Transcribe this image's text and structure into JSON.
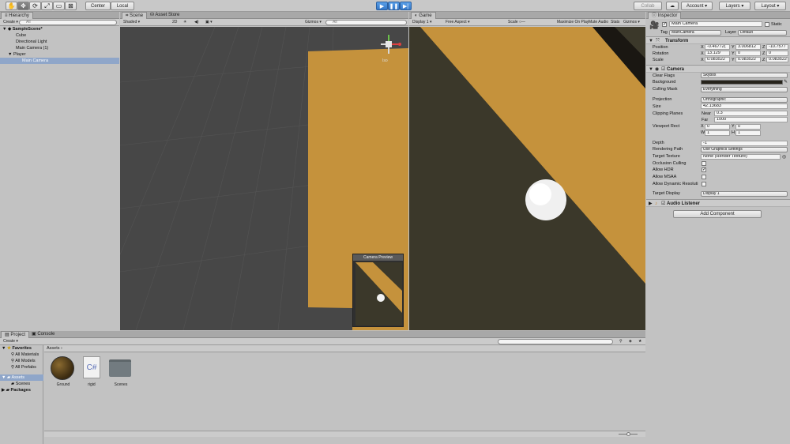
{
  "toolbar": {
    "center_label": "Center",
    "local_label": "Local",
    "collab_label": "Collab",
    "account_label": "Account",
    "layers_label": "Layers",
    "layout_label": "Layout"
  },
  "hierarchy": {
    "tab_label": "Hierarchy",
    "create_label": "Create",
    "search_placeholder": "All",
    "items": [
      {
        "label": "SampleScene*"
      },
      {
        "label": "Cube"
      },
      {
        "label": "Directional Light"
      },
      {
        "label": "Main Camera (1)"
      },
      {
        "label": "Player"
      },
      {
        "label": "Main Camera"
      }
    ]
  },
  "scene": {
    "tab_label": "Scene",
    "asset_store_label": "Asset Store",
    "shaded_label": "Shaded",
    "mode_2d_label": "2D",
    "gizmos_label": "Gizmos",
    "search_placeholder": "All",
    "iso_label": "Iso",
    "camera_preview_label": "Camera Preview"
  },
  "game": {
    "tab_label": "Game",
    "display_label": "Display 1",
    "aspect_label": "Free Aspect",
    "scale_label": "Scale",
    "maximize_label": "Maximize On Play",
    "mute_label": "Mute Audio",
    "stats_label": "Stats",
    "gizmos_label": "Gizmos"
  },
  "inspector": {
    "tab_label": "Inspector",
    "object_name": "Main Camera",
    "static_label": "Static",
    "tag_label": "Tag",
    "tag_value": "MainCamera",
    "layer_label": "Layer",
    "layer_value": "Default",
    "transform": {
      "title": "Transform",
      "position_label": "Position",
      "rotation_label": "Rotation",
      "scale_label": "Scale",
      "position": {
        "x": "-0.46772(",
        "y": "3.006812",
        "z": "-10.7577"
      },
      "rotation": {
        "x": "13.129",
        "y": "0",
        "z": "0"
      },
      "scale": {
        "x": "0.083522",
        "y": "0.083522",
        "z": "0.083522"
      }
    },
    "camera": {
      "title": "Camera",
      "clear_flags_label": "Clear Flags",
      "clear_flags_value": "Skybox",
      "background_label": "Background",
      "culling_mask_label": "Culling Mask",
      "culling_mask_value": "Everything",
      "projection_label": "Projection",
      "projection_value": "Orthographic",
      "size_label": "Size",
      "size_value": "42.13683",
      "clipping_label": "Clipping Planes",
      "near_label": "Near",
      "near_value": "0.3",
      "far_label": "Far",
      "far_value": "1000",
      "viewport_label": "Viewport Rect",
      "vp_x_label": "X",
      "vp_x": "0",
      "vp_y_label": "Y",
      "vp_y": "0",
      "vp_w_label": "W",
      "vp_w": "1",
      "vp_h_label": "H",
      "vp_h": "1",
      "depth_label": "Depth",
      "depth_value": "-1",
      "rendering_path_label": "Rendering Path",
      "rendering_path_value": "Use Graphics Settings",
      "target_texture_label": "Target Texture",
      "target_texture_value": "None (Render Texture)",
      "occlusion_label": "Occlusion Culling",
      "hdr_label": "Allow HDR",
      "msaa_label": "Allow MSAA",
      "dynamic_label": "Allow Dynamic Resoluti",
      "target_display_label": "Target Display",
      "target_display_value": "Display 1"
    },
    "audio_listener_title": "Audio Listener",
    "add_component_label": "Add Component"
  },
  "project": {
    "tab_label": "Project",
    "console_label": "Console",
    "create_label": "Create",
    "favorites_label": "Favorites",
    "favorites": [
      "All Materials",
      "All Models",
      "All Prefabs"
    ],
    "assets_label": "Assets",
    "scenes_label": "Scenes",
    "packages_label": "Packages",
    "breadcrumb": "Assets",
    "assets": [
      {
        "name": "Ground",
        "icon": "material-icon"
      },
      {
        "name": "rigid",
        "icon": "csharp-icon"
      },
      {
        "name": "Scenes",
        "icon": "folder-icon"
      }
    ]
  },
  "colors": {
    "panel_bg": "#c2c2c2",
    "scene_bg": "#474747",
    "game_bg": "#3b382a",
    "plane": "#c5923c",
    "selection": "#8fa6c9",
    "play_blue": "#3578c8"
  }
}
